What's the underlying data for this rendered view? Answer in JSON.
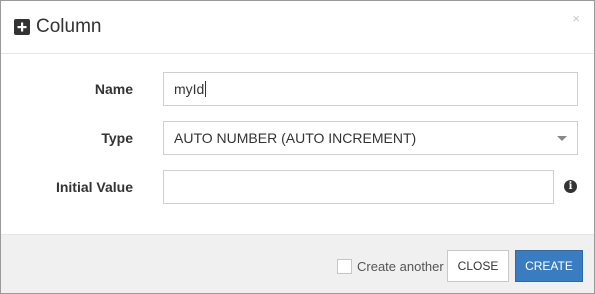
{
  "dialog": {
    "title": "Column",
    "title_icon": "plus-square-icon",
    "close_glyph": "×"
  },
  "form": {
    "name": {
      "label": "Name",
      "value": "myId"
    },
    "type": {
      "label": "Type",
      "value": "AUTO NUMBER (AUTO INCREMENT)"
    },
    "initial_value": {
      "label": "Initial Value",
      "value": "",
      "info_icon": "info-circle-icon",
      "info_glyph": "i"
    }
  },
  "footer": {
    "create_another_label": "Create another",
    "create_another_checked": false,
    "close_label": "CLOSE",
    "create_label": "CREATE"
  },
  "colors": {
    "primary": "#3a7cc0",
    "footer_bg": "#f0f0f0",
    "border": "#cfcfcf"
  }
}
